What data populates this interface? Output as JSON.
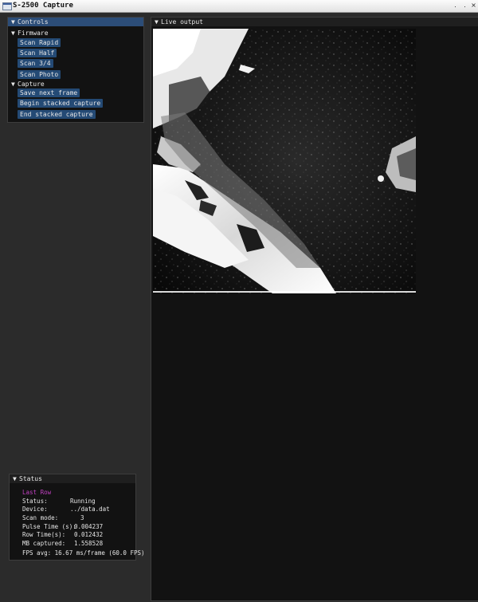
{
  "app": {
    "title": "S-2500 Capture",
    "min_label": "․",
    "max_label": "․",
    "close_label": "×"
  },
  "controls": {
    "title": "Controls",
    "firmware": {
      "label": "Firmware",
      "buttons": [
        "Scan Rapid",
        "Scan Half",
        "Scan 3/4",
        "Scan Photo"
      ]
    },
    "capture": {
      "label": "Capture",
      "buttons": [
        "Save next frame",
        "Begin stacked capture",
        "End stacked capture"
      ]
    }
  },
  "live": {
    "title": "Live output",
    "image_icon": "sem-image"
  },
  "status": {
    "title": "Status",
    "last_row_label": "Last Row",
    "rows": [
      {
        "label": "Status:",
        "value": "Running"
      },
      {
        "label": "Device:",
        "value": "../data.dat"
      },
      {
        "label": "Scan mode:",
        "value": "3"
      },
      {
        "label": "Pulse Time (s):",
        "value": "0.004237"
      },
      {
        "label": "Row Time(s):",
        "value": "0.012432"
      },
      {
        "label": "MB captured:",
        "value": "1.558528"
      }
    ],
    "fps": "FPS avg: 16.67 ms/frame (60.0 FPS)"
  },
  "colors": {
    "accent": "#2c4d78",
    "button": "#244a75",
    "last_row": "#c040c0"
  }
}
